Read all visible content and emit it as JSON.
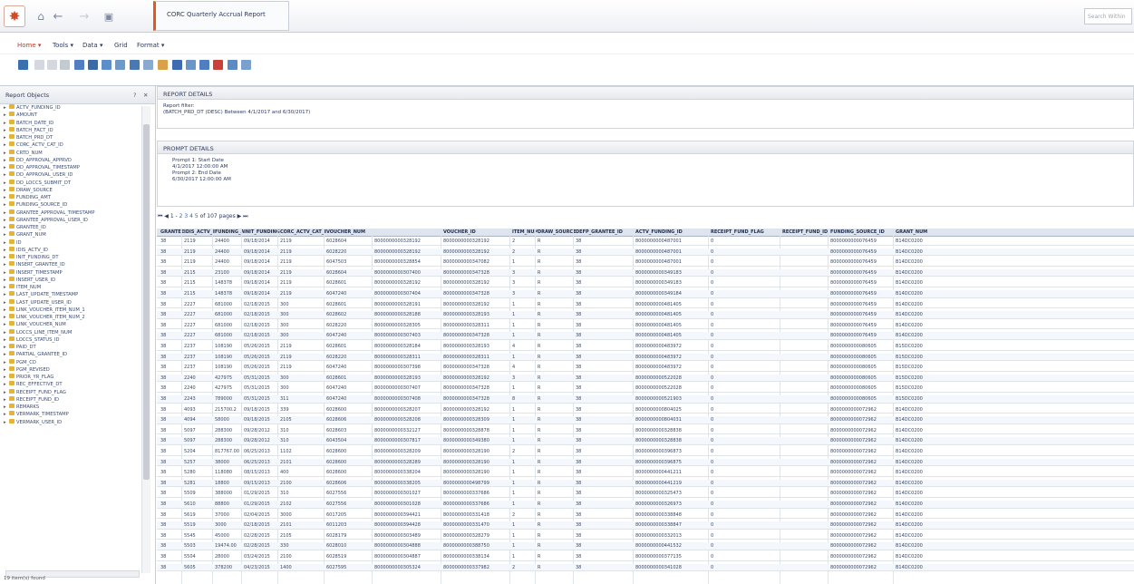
{
  "header": {
    "report_tab": "CORC Quarterly Accrual Report",
    "search_placeholder": "Search Within"
  },
  "menu": {
    "home": "Home ▾",
    "tools": "Tools ▾",
    "data": "Data ▾",
    "grid": "Grid",
    "format": "Format ▾"
  },
  "left_panel": {
    "title": "Report Objects",
    "items": [
      "ACTV_FUNDING_ID",
      "AMOUNT",
      "BATCH_DATE_ID",
      "BATCH_FACT_ID",
      "BATCH_PRD_DT",
      "CORC_ACTV_CAT_ID",
      "CRTD_NUM",
      "DD_APPROVAL_APPRVD",
      "DD_APPROVAL_TIMESTAMP",
      "DD_APPROVAL_USER_ID",
      "DD_LOCCS_SUBMIT_DT",
      "DRAW_SOURCE",
      "FUNDING_AMT",
      "FUNDING_SOURCE_ID",
      "GRANTEE_APPROVAL_TIMESTAMP",
      "GRANTEE_APPROVAL_USER_ID",
      "GRANTEE_ID",
      "GRANT_NUM",
      "ID",
      "IDIS_ACTV_ID",
      "INIT_FUNDING_DT",
      "INSERT_GRANTEE_ID",
      "INSERT_TIMESTAMP",
      "INSERT_USER_ID",
      "ITEM_NUM",
      "LAST_UPDATE_TIMESTAMP",
      "LAST_UPDATE_USER_ID",
      "LINK_VOUCHER_ITEM_NUM_1",
      "LINK_VOUCHER_ITEM_NUM_2",
      "LINK_VOUCHER_NUM",
      "LOCCS_LINE_ITEM_NUM",
      "LOCCS_STATUS_ID",
      "PAID_DT",
      "PARTIAL_GRANTEE_ID",
      "PGM_CD",
      "PGM_REVISED",
      "PRIOR_YR_FLAG",
      "REC_EFFECTIVE_DT",
      "RECEIPT_FUND_FLAG",
      "RECEIPT_FUND_ID",
      "REMARKS",
      "VERMARK_TIMESTAMP",
      "VERMARK_USER_ID"
    ],
    "footer": "19 item(s) found"
  },
  "filter_section": {
    "title": "REPORT DETAILS",
    "line1": "Report filter:",
    "line2": "(BATCH_PRD_DT (DESC) Between 4/1/2017 and 6/30/2017)"
  },
  "prompt_section": {
    "title": "PROMPT DETAILS",
    "lines": [
      "Prompt 1: Start Date",
      "4/1/2017 12:00:00 AM",
      "Prompt 2: End Date",
      "6/30/2017 12:00:00 AM"
    ]
  },
  "pager": {
    "controls": "⏮ ◀ 1 -",
    "pages": "2 3 4 5",
    "info": "of 107 pages",
    "next": "▶ ⏭"
  },
  "grid": {
    "columns": [
      "GRANTEE_ID",
      "IDIS_ACTV_ID",
      "FUNDING_AMT",
      "INIT_FUNDING_DT",
      "CORC_ACTV_CAT_ID",
      "VOUCHER_NUM",
      "",
      "VOUCHER_ID",
      "ITEM_NUM",
      "DRAW_SOURCE",
      "DEFP_GRANTEE_ID",
      "ACTV_FUNDING_ID",
      "RECEIPT_FUND_FLAG",
      "RECEIPT_FUND_ID",
      "FUNDING_SOURCE_ID",
      "GRANT_NUM"
    ],
    "rows": [
      [
        "38",
        "2119",
        "24400",
        "09/18/2014",
        "2119",
        "6028604",
        "8000000000328192",
        "8000000000328192",
        "2",
        "R",
        "38",
        "8000000000487001",
        "0",
        "",
        "8000000000076459",
        "B14DC0200"
      ],
      [
        "38",
        "2119",
        "24400",
        "09/18/2014",
        "2119",
        "6028220",
        "8000000000328192",
        "8000000000328192",
        "2",
        "R",
        "38",
        "8000000000487001",
        "0",
        "",
        "8000000000076459",
        "B14DC0200"
      ],
      [
        "38",
        "2119",
        "24400",
        "09/18/2014",
        "2119",
        "6047503",
        "8000000000328854",
        "8000000000347082",
        "1",
        "R",
        "38",
        "8000000000487001",
        "0",
        "",
        "8000000000076459",
        "B14DC0200"
      ],
      [
        "38",
        "2115",
        "23100",
        "09/18/2014",
        "2119",
        "6028604",
        "8000000000307400",
        "8000000000347328",
        "3",
        "R",
        "38",
        "8000000000349183",
        "0",
        "",
        "8000000000076459",
        "B14DC0200"
      ],
      [
        "38",
        "2115",
        "148378",
        "09/18/2014",
        "2119",
        "6028601",
        "8000000000328192",
        "8000000000328192",
        "3",
        "R",
        "38",
        "8000000000349183",
        "0",
        "",
        "8000000000076459",
        "B14DC0200"
      ],
      [
        "38",
        "2115",
        "148378",
        "09/18/2014",
        "2119",
        "6047240",
        "8000000000307404",
        "8000000000347328",
        "3",
        "R",
        "38",
        "8000000000349184",
        "0",
        "",
        "8000000000076459",
        "B14DC0200"
      ],
      [
        "38",
        "2227",
        "681000",
        "02/18/2015",
        "300",
        "6028601",
        "8000000000328191",
        "8000000000328192",
        "1",
        "R",
        "38",
        "8000000000481405",
        "0",
        "",
        "8000000000076459",
        "B14DC0200"
      ],
      [
        "38",
        "2227",
        "681000",
        "02/18/2015",
        "300",
        "6028602",
        "8000000000328188",
        "8000000000328193",
        "1",
        "R",
        "38",
        "8000000000481405",
        "0",
        "",
        "8000000000076459",
        "B14DC0200"
      ],
      [
        "38",
        "2227",
        "681000",
        "02/18/2015",
        "300",
        "6028220",
        "8000000000328305",
        "8000000000328311",
        "1",
        "R",
        "38",
        "8000000000481405",
        "0",
        "",
        "8000000000076459",
        "B14DC0200"
      ],
      [
        "38",
        "2227",
        "681000",
        "02/18/2015",
        "300",
        "6047240",
        "8000000000307403",
        "8000000000347328",
        "1",
        "R",
        "38",
        "8000000000481405",
        "0",
        "",
        "8000000000076459",
        "B14DC0200"
      ],
      [
        "38",
        "2237",
        "108190",
        "05/26/2015",
        "2119",
        "6028601",
        "8000000000328184",
        "8000000000328193",
        "4",
        "R",
        "38",
        "8000000000483972",
        "0",
        "",
        "8000000000080605",
        "B15DC0200"
      ],
      [
        "38",
        "2237",
        "108190",
        "05/26/2015",
        "2119",
        "6028220",
        "8000000000328311",
        "8000000000328311",
        "1",
        "R",
        "38",
        "8000000000483972",
        "0",
        "",
        "8000000000080605",
        "B15DC0200"
      ],
      [
        "38",
        "2237",
        "108190",
        "05/26/2015",
        "2119",
        "6047240",
        "8000000000307398",
        "8000000000347328",
        "4",
        "R",
        "38",
        "8000000000483972",
        "0",
        "",
        "8000000000080605",
        "B15DC0200"
      ],
      [
        "38",
        "2240",
        "427975",
        "05/31/2015",
        "300",
        "6028601",
        "8000000000328193",
        "8000000000328192",
        "3",
        "R",
        "38",
        "8000000000522028",
        "0",
        "",
        "8000000000080605",
        "B15DC0200"
      ],
      [
        "38",
        "2240",
        "427975",
        "05/31/2015",
        "300",
        "6047240",
        "8000000000307407",
        "8000000000347328",
        "1",
        "R",
        "38",
        "8000000000522028",
        "0",
        "",
        "8000000000080605",
        "B15DC0200"
      ],
      [
        "38",
        "2243",
        "789000",
        "05/31/2015",
        "311",
        "6047240",
        "8000000000307408",
        "8000000000347328",
        "8",
        "R",
        "38",
        "8000000000521903",
        "0",
        "",
        "8000000000080605",
        "B15DC0200"
      ],
      [
        "38",
        "4093",
        "215700.2",
        "09/18/2015",
        "339",
        "6028600",
        "8000000000328207",
        "8000000000328192",
        "1",
        "R",
        "38",
        "8000000000804025",
        "0",
        "",
        "8000000000072962",
        "B14DC0200"
      ],
      [
        "38",
        "4094",
        "58000",
        "09/18/2015",
        "2105",
        "6028606",
        "8000000000328208",
        "8000000000328309",
        "1",
        "R",
        "38",
        "8000000000804031",
        "0",
        "",
        "8000000000072962",
        "B14DC0200"
      ],
      [
        "38",
        "5097",
        "288300",
        "09/28/2012",
        "310",
        "6028603",
        "8000000000332127",
        "8000000000328878",
        "1",
        "R",
        "38",
        "8000000000328838",
        "0",
        "",
        "8000000000072962",
        "B14DC0200"
      ],
      [
        "38",
        "5097",
        "288300",
        "09/28/2012",
        "310",
        "6043504",
        "8000000000307817",
        "8000000000349380",
        "1",
        "R",
        "38",
        "8000000000328838",
        "0",
        "",
        "8000000000072962",
        "B14DC0200"
      ],
      [
        "38",
        "5204",
        "817767.00",
        "06/25/2013",
        "1102",
        "6028600",
        "8000000000328209",
        "8000000000328190",
        "2",
        "R",
        "38",
        "8000000000396873",
        "0",
        "",
        "8000000000072962",
        "B14DC0200"
      ],
      [
        "38",
        "5257",
        "38000",
        "06/25/2013",
        "2101",
        "6028600",
        "8000000000328289",
        "8000000000328190",
        "1",
        "R",
        "38",
        "8000000000396875",
        "0",
        "",
        "8000000000072962",
        "B14DC0200"
      ],
      [
        "38",
        "5280",
        "118080",
        "08/15/2013",
        "400",
        "6028600",
        "8000000000338204",
        "8000000000328190",
        "1",
        "R",
        "38",
        "8000000000441211",
        "0",
        "",
        "8000000000072962",
        "B14DC0200"
      ],
      [
        "38",
        "5281",
        "18800",
        "09/15/2013",
        "2100",
        "6028606",
        "8000000000338205",
        "8000000000498799",
        "1",
        "R",
        "38",
        "8000000000441219",
        "0",
        "",
        "8000000000072962",
        "B14DC0200"
      ],
      [
        "38",
        "5509",
        "388000",
        "01/29/2015",
        "310",
        "6027556",
        "8000000000301027",
        "8000000000337686",
        "1",
        "R",
        "38",
        "8000000000325473",
        "0",
        "",
        "8000000000072962",
        "B14DC0200"
      ],
      [
        "38",
        "5610",
        "88800",
        "01/29/2015",
        "2102",
        "6027556",
        "8000000000301028",
        "8000000000337686",
        "1",
        "R",
        "38",
        "8000000000326973",
        "0",
        "",
        "8000000000072962",
        "B14DC0200"
      ],
      [
        "38",
        "5619",
        "37000",
        "02/04/2015",
        "3000",
        "6017205",
        "8000000000394421",
        "8000000000331418",
        "2",
        "R",
        "38",
        "8000000000338848",
        "0",
        "",
        "8000000000072962",
        "B14DC0200"
      ],
      [
        "38",
        "5519",
        "3000",
        "02/18/2015",
        "2101",
        "6011203",
        "8000000000394428",
        "8000000000331470",
        "1",
        "R",
        "38",
        "8000000000338847",
        "0",
        "",
        "8000000000072962",
        "B14DC0200"
      ],
      [
        "38",
        "5545",
        "45000",
        "02/28/2015",
        "2105",
        "6028179",
        "8000000000303489",
        "8000000000328279",
        "1",
        "R",
        "38",
        "8000000000332013",
        "0",
        "",
        "8000000000072962",
        "B14DC0200"
      ],
      [
        "38",
        "5503",
        "19474.00",
        "02/28/2015",
        "330",
        "6028010",
        "8000000000304888",
        "8000000000388750",
        "1",
        "R",
        "38",
        "8000000000441532",
        "0",
        "",
        "8000000000072962",
        "B14DC0200"
      ],
      [
        "38",
        "5504",
        "28000",
        "03/24/2015",
        "2100",
        "6028519",
        "8000000000304887",
        "8000000000338134",
        "1",
        "R",
        "38",
        "8000000000377135",
        "0",
        "",
        "8000000000072962",
        "B14DC0200"
      ],
      [
        "38",
        "5605",
        "378200",
        "04/23/2015",
        "1400",
        "6027595",
        "8000000000305324",
        "8000000000337982",
        "2",
        "R",
        "38",
        "8000000000341028",
        "0",
        "",
        "8000000000072962",
        "B14DC0200"
      ]
    ]
  },
  "colors": {
    "accent": "#e4581f",
    "link": "#3a5fb0",
    "header_bg": "#dfe5ee"
  }
}
